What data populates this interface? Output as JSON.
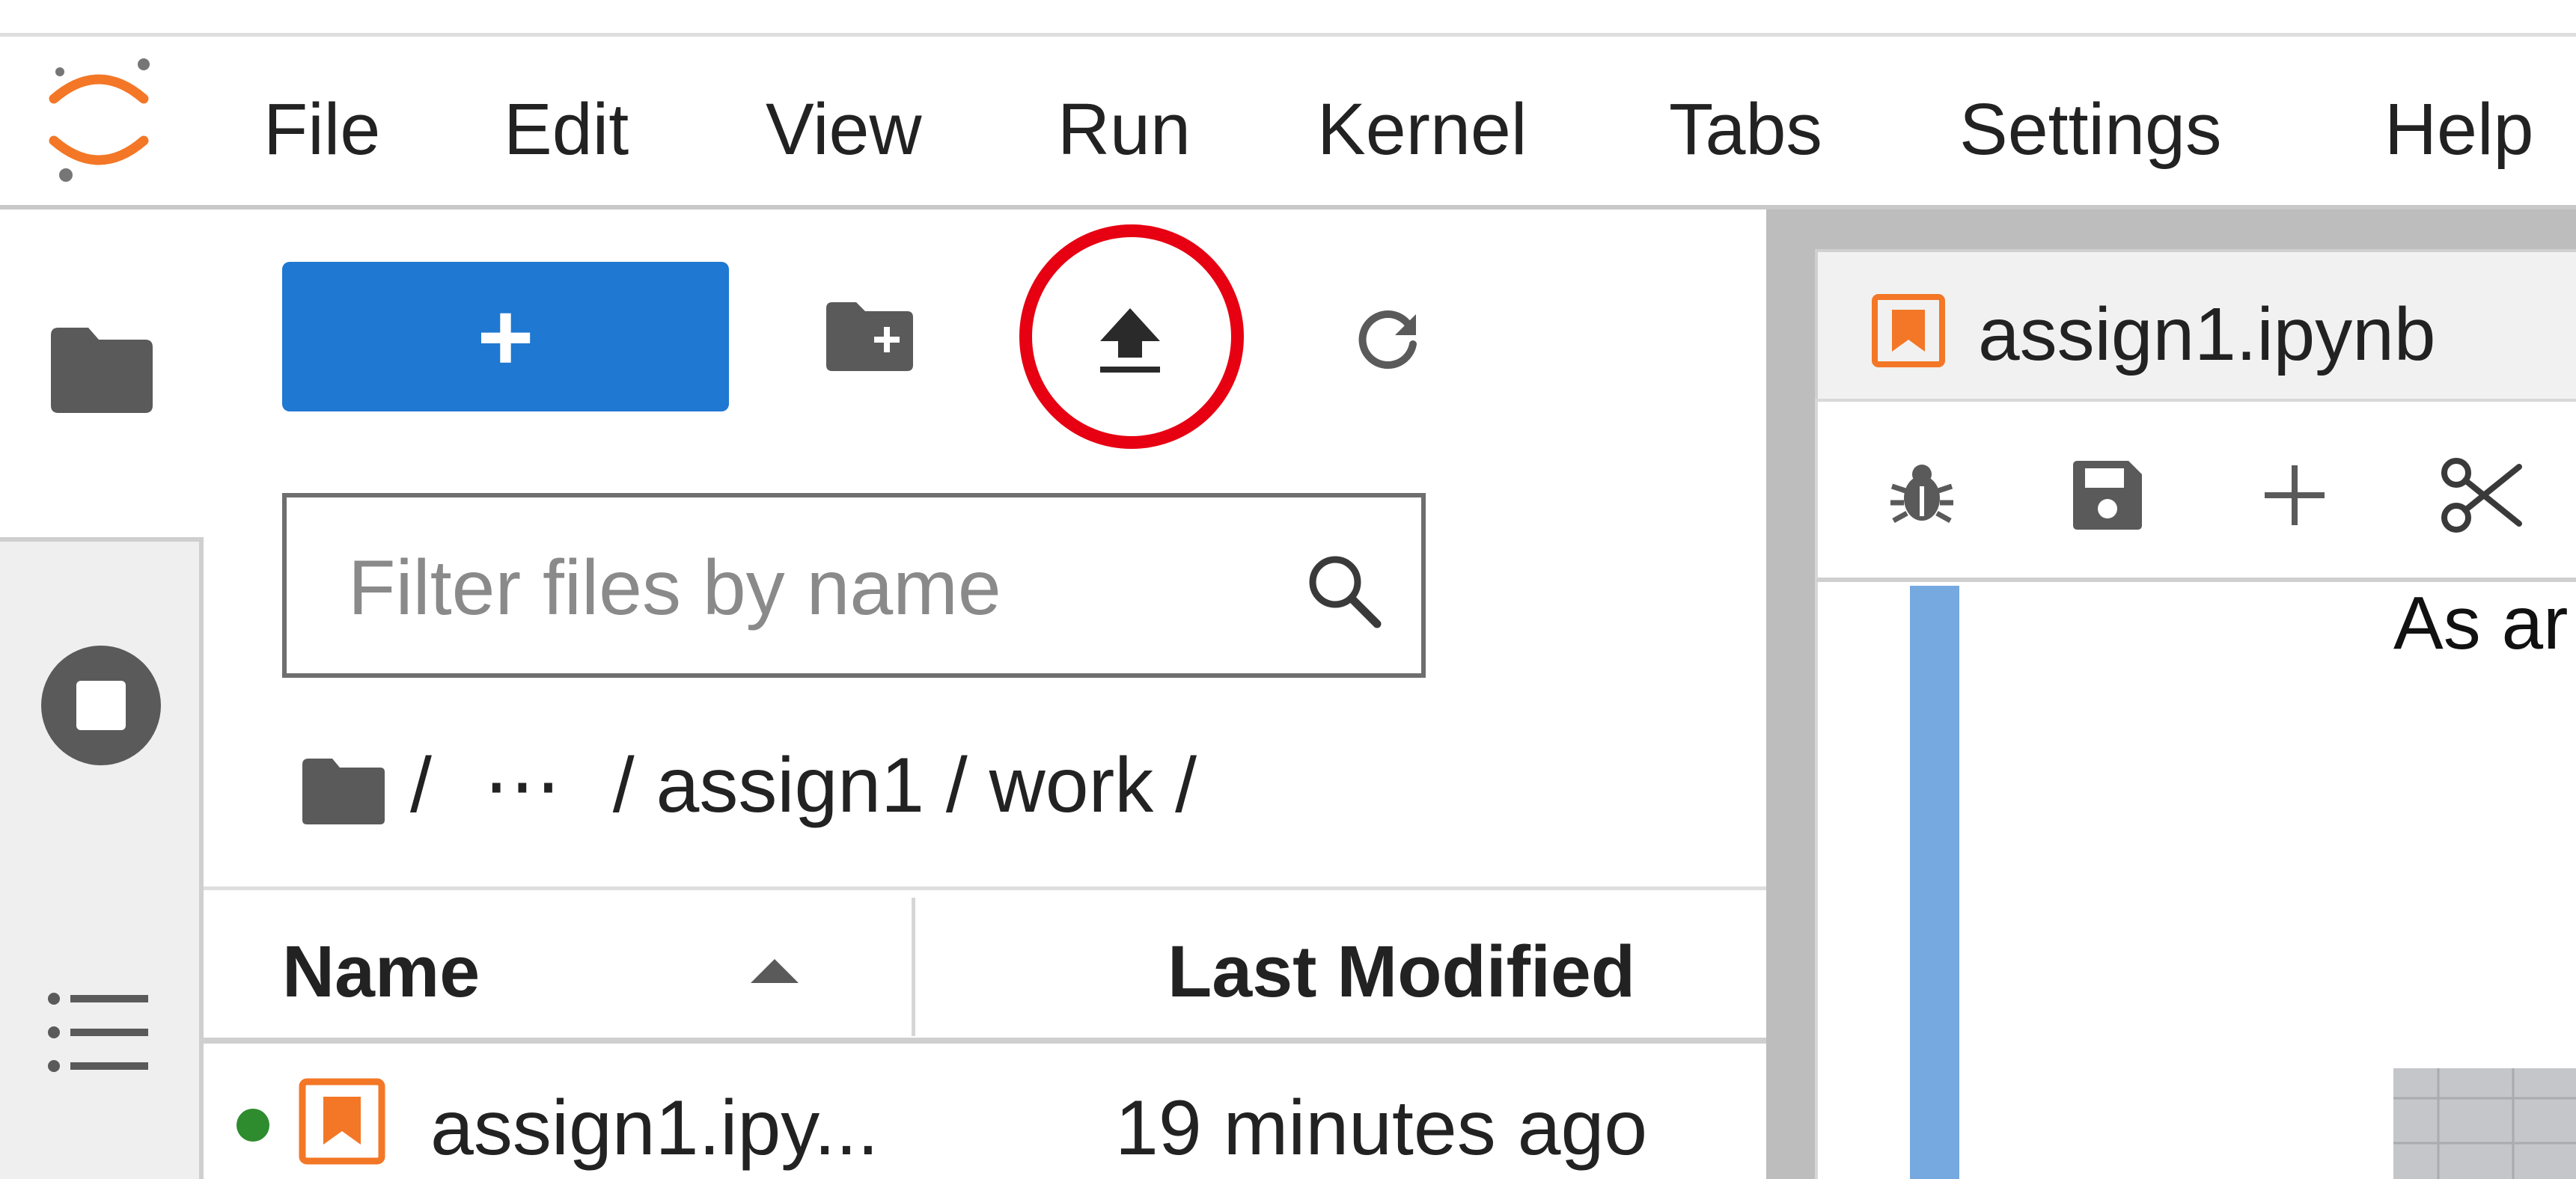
{
  "menubar": {
    "items": [
      "File",
      "Edit",
      "View",
      "Run",
      "Kernel",
      "Tabs",
      "Settings",
      "Help"
    ]
  },
  "activity_bar": {
    "icons": [
      "folder-icon",
      "running-stop-icon",
      "table-of-contents-icon"
    ]
  },
  "file_browser": {
    "new_button_label": "+",
    "toolbar_icons": [
      "new-folder-icon",
      "upload-icon",
      "refresh-icon"
    ],
    "search_placeholder": "Filter files by name",
    "breadcrumb": {
      "root": "/",
      "ellipsis": "⋯",
      "path": "/ assign1 / work /"
    },
    "columns": {
      "name": "Name",
      "modified": "Last Modified"
    },
    "files": [
      {
        "name": "assign1.ipy...",
        "modified": "19 minutes ago",
        "running": true
      }
    ]
  },
  "main": {
    "tab_label": "assign1.ipynb",
    "toolbar_icons": [
      "debug-icon",
      "save-icon",
      "add-cell-icon",
      "cut-icon"
    ],
    "cell_text_fragment": "As ar"
  },
  "colors": {
    "accent": "#1f78d1",
    "highlight": "#e60012",
    "notebook_icon": "#f37726",
    "running_dot": "#2e8b2e",
    "cell_selection": "#75a9e0"
  }
}
